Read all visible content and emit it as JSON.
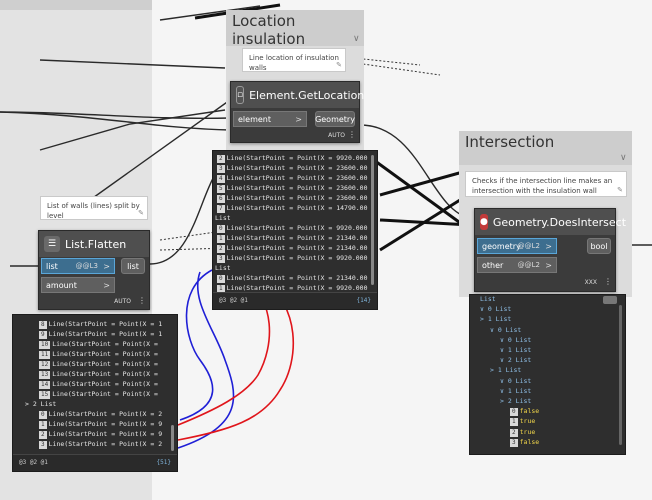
{
  "groups": {
    "location": {
      "title": "Location insulation",
      "note": "Line location of insulation walls"
    },
    "intersection": {
      "title": "Intersection",
      "note": "Checks if the intersection line makes an intersection with the insulation wall"
    },
    "walls_note": "List of walls (lines) split by level"
  },
  "nodes": {
    "get_location": {
      "title": "Element.GetLocation",
      "input": "element",
      "output": "Geometry",
      "lacing": "AUTO"
    },
    "flatten": {
      "title": "List.Flatten",
      "input1": "list",
      "input1_lace": "@@L3",
      "input2": "amount",
      "output": "list",
      "lacing": "AUTO"
    },
    "does_intersect": {
      "title": "Geometry.DoesIntersect",
      "input1": "geometry",
      "input1_lace": "@@L2",
      "input2": "other",
      "input2_lace": "@@L2",
      "output": "bool",
      "lacing": "XXX"
    }
  },
  "previews": {
    "center": {
      "rows": [
        {
          "idx": "2",
          "text": "Line(StartPoint = Point(X = 9920.000"
        },
        {
          "idx": "3",
          "text": "Line(StartPoint = Point(X = 23600.00"
        },
        {
          "idx": "4",
          "text": "Line(StartPoint = Point(X = 23600.00"
        },
        {
          "idx": "5",
          "text": "Line(StartPoint = Point(X = 23600.00"
        },
        {
          "idx": "6",
          "text": "Line(StartPoint = Point(X = 23600.00"
        },
        {
          "idx": "7",
          "text": "Line(StartPoint = Point(X = 14790.00"
        },
        {
          "idx": "",
          "text": "List"
        },
        {
          "idx": "0",
          "text": "Line(StartPoint = Point(X = 9920.000"
        },
        {
          "idx": "1",
          "text": "Line(StartPoint = Point(X = 21340.00"
        },
        {
          "idx": "2",
          "text": "Line(StartPoint = Point(X = 21340.00"
        },
        {
          "idx": "3",
          "text": "Line(StartPoint = Point(X = 9920.000"
        },
        {
          "idx": "",
          "text": "List"
        },
        {
          "idx": "0",
          "text": "Line(StartPoint = Point(X = 21340.00"
        },
        {
          "idx": "1",
          "text": "Line(StartPoint = Point(X = 9920.000"
        }
      ],
      "levels": "@3 @2 @1",
      "count": "{14}"
    },
    "left": {
      "rows": [
        {
          "idx": "8",
          "text": "Line(StartPoint = Point(X = 1"
        },
        {
          "idx": "9",
          "text": "Line(StartPoint = Point(X = 1"
        },
        {
          "idx": "10",
          "text": "Line(StartPoint = Point(X ="
        },
        {
          "idx": "11",
          "text": "Line(StartPoint = Point(X ="
        },
        {
          "idx": "12",
          "text": "Line(StartPoint = Point(X ="
        },
        {
          "idx": "13",
          "text": "Line(StartPoint = Point(X ="
        },
        {
          "idx": "14",
          "text": "Line(StartPoint = Point(X ="
        },
        {
          "idx": "15",
          "text": "Line(StartPoint = Point(X ="
        },
        {
          "idx": "",
          "text": "> 2 List"
        },
        {
          "idx": "0",
          "text": "Line(StartPoint = Point(X = 2"
        },
        {
          "idx": "1",
          "text": "Line(StartPoint = Point(X = 9"
        },
        {
          "idx": "2",
          "text": "Line(StartPoint = Point(X = 9"
        },
        {
          "idx": "3",
          "text": "Line(StartPoint = Point(X = 2"
        }
      ],
      "levels": "@3 @2 @1",
      "count": "{51}"
    },
    "right": {
      "rows": [
        {
          "indent": 0,
          "text": "List"
        },
        {
          "indent": 0,
          "text": "∨ 0 List"
        },
        {
          "indent": 0,
          "text": "> 1 List"
        },
        {
          "indent": 1,
          "text": "∨ 0 List"
        },
        {
          "indent": 2,
          "text": "∨ 0 List"
        },
        {
          "indent": 2,
          "text": "∨ 1 List"
        },
        {
          "indent": 2,
          "text": "∨ 2 List"
        },
        {
          "indent": 1,
          "text": "> 1 List"
        },
        {
          "indent": 2,
          "text": "∨ 0 List"
        },
        {
          "indent": 2,
          "text": "∨ 1 List"
        },
        {
          "indent": 2,
          "text": "> 2 List"
        },
        {
          "indent": 3,
          "idx": "0",
          "val": "false"
        },
        {
          "indent": 3,
          "idx": "1",
          "val": "true"
        },
        {
          "indent": 3,
          "idx": "2",
          "val": "true"
        },
        {
          "indent": 3,
          "idx": "3",
          "val": "false"
        }
      ]
    }
  },
  "colors": {
    "wire_red": "#e0151b",
    "wire_blue": "#1f1fd6",
    "node_bg": "#3b3b3b",
    "select_port": "#3d6e8f"
  }
}
